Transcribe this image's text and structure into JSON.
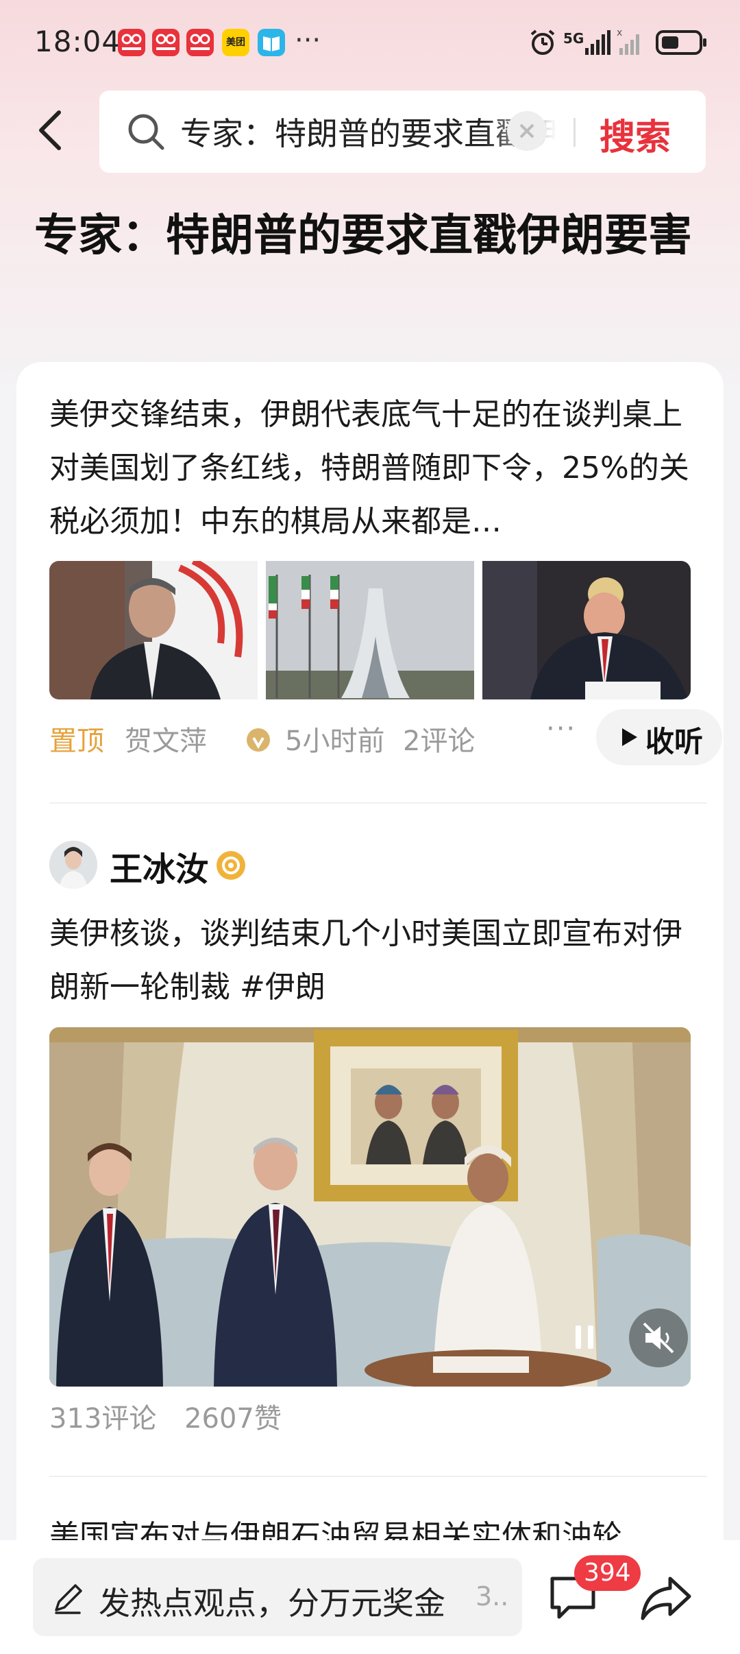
{
  "status_bar": {
    "time": "18:04",
    "apps": [
      {
        "name": "app-icon-1",
        "color": "#e8323c"
      },
      {
        "name": "app-icon-2",
        "color": "#e8323c"
      },
      {
        "name": "app-icon-3",
        "color": "#e8323c"
      },
      {
        "name": "meituan-icon",
        "label": "美团",
        "color": "#ffd000"
      },
      {
        "name": "reader-icon",
        "color": "#2bb5e8"
      }
    ],
    "more": "···",
    "network": "5G"
  },
  "search": {
    "query": "专家：特朗普的要求直戳伊朗要害",
    "submit_label": "搜索"
  },
  "page_title": "专家：特朗普的要求直戳伊朗要害",
  "post1": {
    "text": "美伊交锋结束，伊朗代表底气十足的在谈判桌上对美国划了条红线，特朗普随即下令，25%的关税必须加！中东的棋局从来都是…",
    "pin": "置顶",
    "author": "贺文萍",
    "time": "5小时前",
    "comments": "2评论",
    "more": "···",
    "listen_label": "收听"
  },
  "post2": {
    "author": "王冰汝",
    "text": "美伊核谈，谈判结束几个小时美国立即宣布对伊朗新一轮制裁 #伊朗",
    "comments": "313评论",
    "likes": "2607赞"
  },
  "post3": {
    "text": "美国宣布对与伊朗石油贸易相关实体和油轮"
  },
  "bottom_bar": {
    "comment_placeholder": "发热点观点，分万元奖金",
    "comment_suffix": "3..",
    "comment_badge": "394"
  },
  "colors": {
    "accent": "#e8323c",
    "pin": "#e6a23c"
  }
}
